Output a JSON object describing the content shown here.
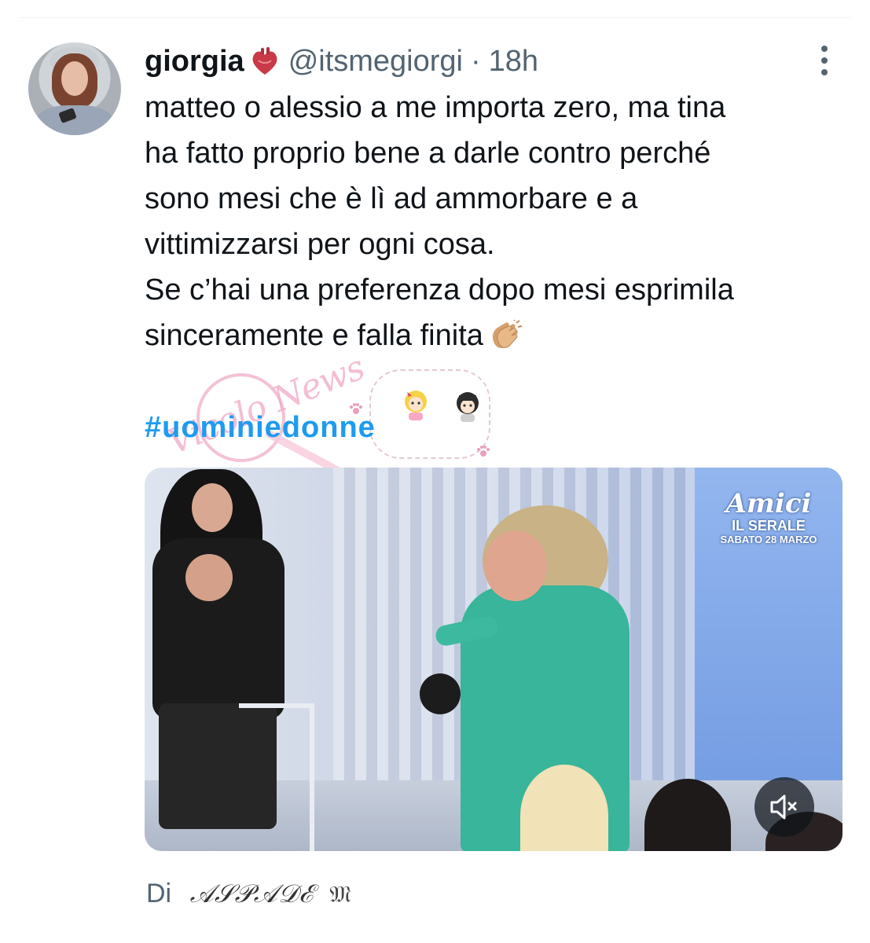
{
  "tweet": {
    "display_name": "giorgia",
    "name_emoji": "heart-anatomical-icon",
    "handle": "@itsmegiorgi",
    "separator": "·",
    "time": "18h",
    "text_lines": [
      "matteo o alessio a me importa zero, ma tina",
      "ha fatto proprio bene a darle contro perché",
      "sono mesi che è lì ad ammorbare e a",
      "vittimizzarsi per ogni cosa.",
      "Se c’hai una preferenza dopo mesi esprimila",
      "sinceramente e falla finita"
    ],
    "end_emoji": "clapping-hands-icon",
    "hashtag": "#uominiedonne"
  },
  "media": {
    "overlay_logo": "Amici",
    "overlay_title": "IL SERALE",
    "overlay_date": "SABATO 28 MARZO",
    "mute_icon": "speaker-muted-icon"
  },
  "watermark": {
    "script_text": "Vicolo News"
  },
  "footer": {
    "by_label": "Di",
    "author": "𝒜𝒮𝒫𝒜𝒟ℰ",
    "author_suffix": "𝔐"
  },
  "colors": {
    "link": "#1d9bf0",
    "secondary": "#536471",
    "text": "#0f1419"
  }
}
